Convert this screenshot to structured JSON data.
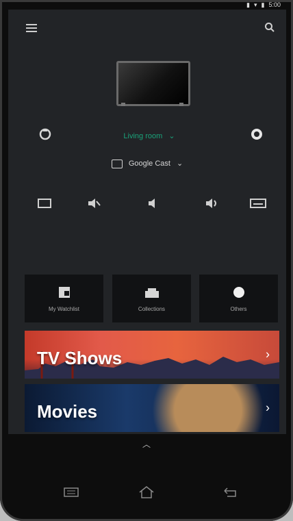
{
  "status_bar": {
    "time": "5:00"
  },
  "remote": {
    "room_label": "Living room",
    "cast_label": "Google Cast",
    "quick_tiles": [
      {
        "label": "My Watchlist",
        "icon": "watchlist-icon"
      },
      {
        "label": "Collections",
        "icon": "collections-icon"
      },
      {
        "label": "Others",
        "icon": "others-icon"
      }
    ],
    "banners": [
      {
        "label": "TV Shows"
      },
      {
        "label": "Movies"
      }
    ]
  },
  "nav": {
    "recent": "recent-apps-icon",
    "home": "home-icon",
    "back": "back-icon"
  }
}
